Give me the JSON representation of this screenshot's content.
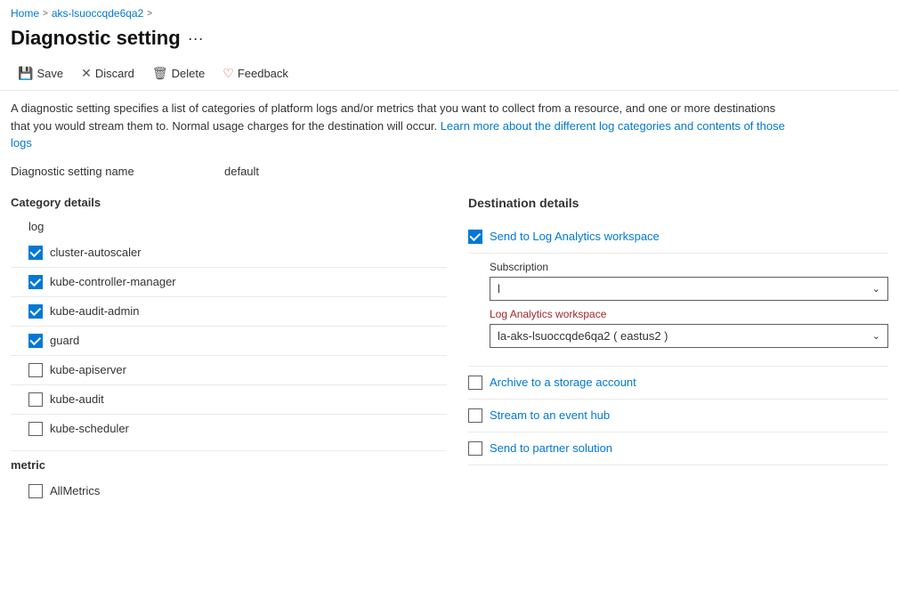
{
  "breadcrumb": {
    "home": "Home",
    "resource": "aks-lsuoccqde6qa2",
    "sep1": ">",
    "sep2": ">"
  },
  "page": {
    "title": "Diagnostic setting",
    "more_icon": "···"
  },
  "toolbar": {
    "save": "Save",
    "discard": "Discard",
    "delete": "Delete",
    "feedback": "Feedback"
  },
  "description": {
    "text1": "A diagnostic setting specifies a list of categories of platform logs and/or metrics that you want to collect from a resource, and one or more destinations that you would stream them to. Normal usage charges for the destination will occur. ",
    "link": "Learn more about the different log categories and contents of those logs"
  },
  "setting_name": {
    "label": "Diagnostic setting name",
    "value": "default"
  },
  "category_details": {
    "header": "Category details",
    "log_header": "log",
    "items": [
      {
        "label": "cluster-autoscaler",
        "checked": true
      },
      {
        "label": "kube-controller-manager",
        "checked": true
      },
      {
        "label": "kube-audit-admin",
        "checked": true
      },
      {
        "label": "guard",
        "checked": true
      },
      {
        "label": "kube-apiserver",
        "checked": false
      },
      {
        "label": "kube-audit",
        "checked": false
      },
      {
        "label": "kube-scheduler",
        "checked": false
      }
    ],
    "metric_header": "metric",
    "metric_items": [
      {
        "label": "AllMetrics",
        "checked": false
      }
    ]
  },
  "destination_details": {
    "header": "Destination details",
    "log_analytics": {
      "label": "Send to Log Analytics workspace",
      "checked": true,
      "subscription_label": "Subscription",
      "subscription_value": "l",
      "workspace_label": "Log Analytics workspace",
      "workspace_value": "la-aks-lsuoccqde6qa2 ( eastus2 )"
    },
    "storage": {
      "label": "Archive to a storage account",
      "checked": false
    },
    "event_hub": {
      "label": "Stream to an event hub",
      "checked": false
    },
    "partner": {
      "label": "Send to partner solution",
      "checked": false
    }
  }
}
